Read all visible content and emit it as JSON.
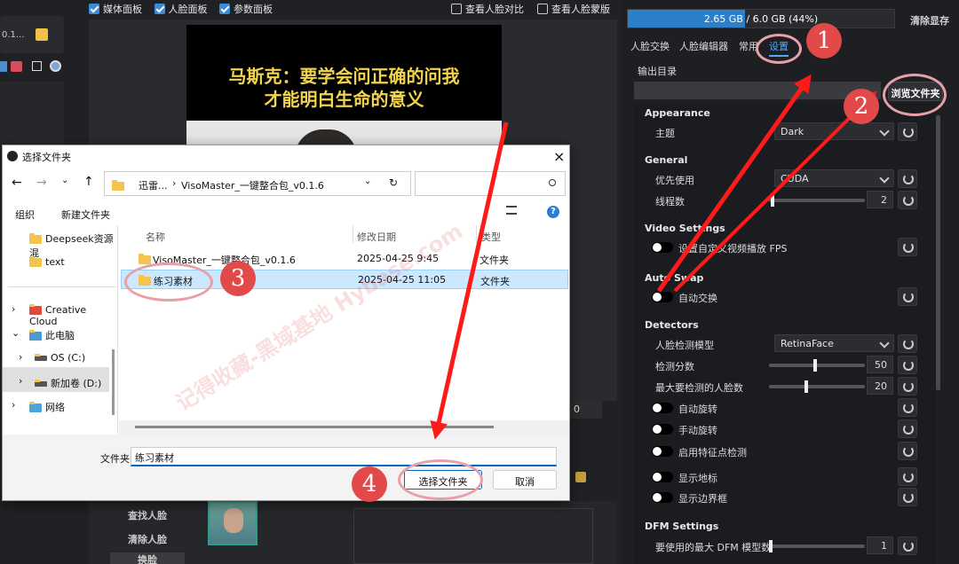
{
  "top_bar": {
    "checkboxes": [
      {
        "label": "媒体面板",
        "checked": true
      },
      {
        "label": "人脸面板",
        "checked": true
      },
      {
        "label": "参数面板",
        "checked": true
      },
      {
        "label": "查看人脸对比",
        "checked": false
      },
      {
        "label": "查看人脸蒙版",
        "checked": false
      }
    ]
  },
  "left_strip": {
    "file_label": "0.1..."
  },
  "video": {
    "subtitle_line1": "马斯克：要学会问正确的问我",
    "subtitle_line2": "才能明白生命的意义"
  },
  "face_buttons": {
    "find": "查找人脸",
    "clear": "清除人脸",
    "swap": "换脸"
  },
  "frame_input": "0",
  "right_panel": {
    "memory_text": "2.65 GB / 6.0 GB (44%)",
    "memory_percent": 44,
    "clear_memory": "清除显存",
    "tabs": [
      "人脸交换",
      "人脸编辑器",
      "常用",
      "设置"
    ],
    "active_tab": "设置",
    "output_dir_label": "输出目录",
    "browse_button": "浏览文件夹",
    "sections": {
      "appearance": "Appearance",
      "general": "General",
      "video": "Video Settings",
      "autoswap": "Auto Swap",
      "detectors": "Detectors",
      "dfm": "DFM Settings"
    },
    "theme_label": "主题",
    "theme_value": "Dark",
    "device_label": "优先使用",
    "device_value": "CUDA",
    "threads_label": "线程数",
    "threads_value": "2",
    "fps_label": "设置自定义视频播放 FPS",
    "autoswap_label": "自动交换",
    "detect_model_label": "人脸检测模型",
    "detect_model_value": "RetinaFace",
    "detect_score_label": "检测分数",
    "detect_score_value": "50",
    "max_faces_label": "最大要检测的人脸数",
    "max_faces_value": "20",
    "auto_rotate": "自动旋转",
    "manual_rotate": "手动旋转",
    "landmark_detect": "启用特征点检测",
    "show_landmarks": "显示地标",
    "show_bbox": "显示边界框",
    "dfm_max_label": "要使用的最大 DFM 模型数",
    "dfm_max_value": "1"
  },
  "dialog": {
    "title": "选择文件夹",
    "breadcrumb": [
      "迅雷...",
      "VisoMaster_一键整合包_v0.1.6"
    ],
    "organize": "组织",
    "new_folder": "新建文件夹",
    "columns": {
      "name": "名称",
      "date": "修改日期",
      "type": "类型"
    },
    "tree": [
      "Deepseek资源混",
      "text",
      "Creative Cloud",
      "此电脑",
      "OS (C:)",
      "新加卷 (D:)",
      "网络"
    ],
    "files": [
      {
        "name": "VisoMaster_一键整合包_v0.1.6",
        "date": "2025-04-25 9:45",
        "type": "文件夹"
      },
      {
        "name": "练习素材",
        "date": "2025-04-25 11:05",
        "type": "文件夹"
      }
    ],
    "folder_label": "文件夹:",
    "folder_value": "练习素材",
    "select_button": "选择文件夹",
    "cancel_button": "取消"
  },
  "annotations": {
    "badges": [
      "1",
      "2",
      "3",
      "4"
    ]
  },
  "watermark": "记得收藏-黑域基地 Hybase.com",
  "colors": {
    "accent": "#3d8bd6",
    "arrow": "#ff1a1a",
    "circle": "#e8a0a8",
    "badge": "#e24a4a"
  }
}
